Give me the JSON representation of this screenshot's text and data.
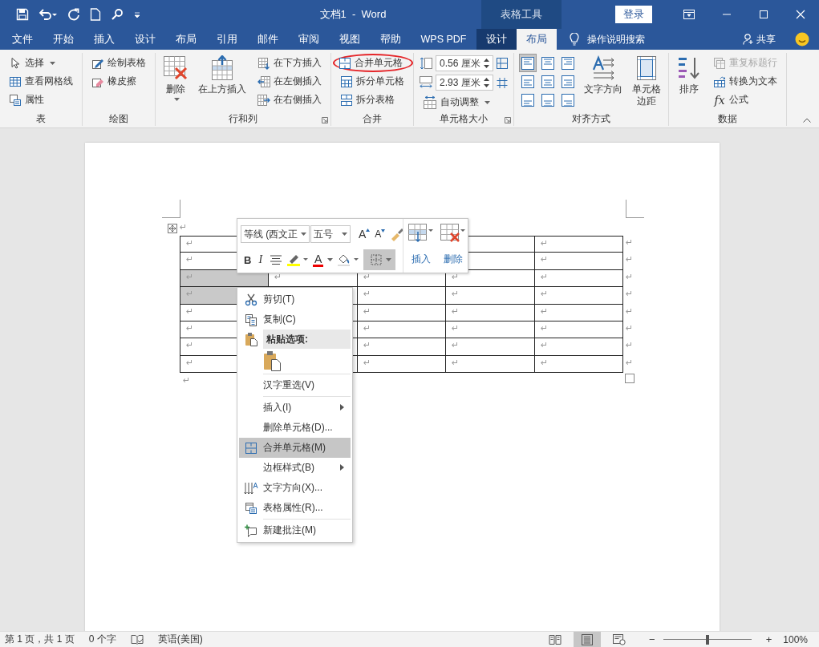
{
  "title_bar": {
    "title": "文档1  -  Word",
    "context_label": "表格工具",
    "sign_in": "登录"
  },
  "menu_tabs": [
    {
      "label": "文件",
      "selected": false,
      "contextual": false
    },
    {
      "label": "开始",
      "selected": false,
      "contextual": false
    },
    {
      "label": "插入",
      "selected": false,
      "contextual": false
    },
    {
      "label": "设计",
      "selected": false,
      "contextual": false
    },
    {
      "label": "布局",
      "selected": false,
      "contextual": false
    },
    {
      "label": "引用",
      "selected": false,
      "contextual": false
    },
    {
      "label": "邮件",
      "selected": false,
      "contextual": false
    },
    {
      "label": "审阅",
      "selected": false,
      "contextual": false
    },
    {
      "label": "视图",
      "selected": false,
      "contextual": false
    },
    {
      "label": "帮助",
      "selected": false,
      "contextual": false
    },
    {
      "label": "WPS PDF",
      "selected": false,
      "contextual": false
    },
    {
      "label": "设计",
      "selected": false,
      "contextual": true
    },
    {
      "label": "布局",
      "selected": true,
      "contextual": true
    }
  ],
  "tell_me": "操作说明搜索",
  "share": "共享",
  "ribbon": [
    {
      "label": "表",
      "launcher": false,
      "items": [
        {
          "kind": "stack",
          "buttons": [
            {
              "label": "选择",
              "dropdown": true,
              "disabled": false,
              "circled": false
            },
            {
              "label": "查看网格线",
              "dropdown": false,
              "disabled": false,
              "circled": false
            },
            {
              "label": "属性",
              "dropdown": false,
              "disabled": false,
              "circled": false
            }
          ]
        }
      ]
    },
    {
      "label": "绘图",
      "launcher": false,
      "items": [
        {
          "kind": "stack",
          "buttons": [
            {
              "label": "绘制表格",
              "dropdown": false,
              "disabled": false,
              "circled": false
            },
            {
              "label": "橡皮擦",
              "dropdown": false,
              "disabled": false,
              "circled": false
            }
          ]
        }
      ]
    },
    {
      "label": "行和列",
      "launcher": true,
      "items": [
        {
          "kind": "large",
          "lines": [
            "删除"
          ],
          "dropdown": true
        },
        {
          "kind": "large",
          "lines": [
            "在上方插入"
          ],
          "dropdown": false
        },
        {
          "kind": "stack",
          "buttons": [
            {
              "label": "在下方插入",
              "dropdown": false,
              "disabled": false,
              "circled": false
            },
            {
              "label": "在左侧插入",
              "dropdown": false,
              "disabled": false,
              "circled": false
            },
            {
              "label": "在右侧插入",
              "dropdown": false,
              "disabled": false,
              "circled": false
            }
          ]
        }
      ]
    },
    {
      "label": "合并",
      "launcher": false,
      "items": [
        {
          "kind": "stack",
          "buttons": [
            {
              "label": "合并单元格",
              "dropdown": false,
              "disabled": false,
              "circled": true
            },
            {
              "label": "拆分单元格",
              "dropdown": false,
              "disabled": false,
              "circled": false
            },
            {
              "label": "拆分表格",
              "dropdown": false,
              "disabled": false,
              "circled": false
            }
          ]
        }
      ]
    },
    {
      "label": "单元格大小",
      "launcher": true,
      "items": [
        {
          "kind": "fields",
          "fields": [
            {
              "value": "0.56 厘米"
            },
            {
              "value": "2.93 厘米"
            }
          ],
          "buttons": [
            {
              "label": "自动调整",
              "dropdown": true,
              "disabled": false,
              "circled": false
            }
          ]
        }
      ]
    },
    {
      "label": "对齐方式",
      "launcher": false,
      "items": [
        {
          "kind": "align-grid",
          "cells": [
            {
              "selected": true
            },
            {
              "selected": false
            },
            {
              "selected": false
            },
            {
              "selected": false
            },
            {
              "selected": false
            },
            {
              "selected": false
            },
            {
              "selected": false
            },
            {
              "selected": false
            },
            {
              "selected": false
            }
          ]
        },
        {
          "kind": "large",
          "lines": [
            "文字方向"
          ],
          "dropdown": false
        },
        {
          "kind": "large",
          "lines": [
            "单元格",
            "边距"
          ],
          "dropdown": false
        }
      ]
    },
    {
      "label": "数据",
      "launcher": false,
      "items": [
        {
          "kind": "large",
          "lines": [
            "排序"
          ],
          "dropdown": false
        },
        {
          "kind": "stack",
          "buttons": [
            {
              "label": "重复标题行",
              "dropdown": false,
              "disabled": true,
              "circled": false
            },
            {
              "label": "转换为文本",
              "dropdown": false,
              "disabled": false,
              "circled": false
            },
            {
              "label": "公式",
              "dropdown": false,
              "disabled": false,
              "circled": false,
              "glyph": "fx"
            }
          ]
        }
      ]
    }
  ],
  "document": {
    "anchor_mark": "↵",
    "after_mark": "↵",
    "table": {
      "rows": [
        {
          "end_mark": "↵",
          "cells": [
            {
              "mark": "↵",
              "selected": false
            },
            {},
            {},
            {
              "selected": false
            },
            {
              "mark": "↵",
              "selected": false
            }
          ]
        },
        {
          "end_mark": "↵",
          "cells": [
            {
              "mark": "↵",
              "selected": false
            },
            {},
            {},
            {
              "selected": false
            },
            {
              "mark": "↵",
              "selected": false
            }
          ]
        },
        {
          "end_mark": "↵",
          "cells": [
            {
              "mark": "↵",
              "selected": true
            },
            {
              "mark": "↵",
              "selected": false
            },
            {
              "mark": "↵",
              "selected": false
            },
            {
              "mark": "↵",
              "selected": false
            },
            {
              "mark": "↵",
              "selected": false
            }
          ]
        },
        {
          "end_mark": "↵",
          "cells": [
            {
              "mark": "↵",
              "selected": true
            },
            {
              "selected": false
            },
            {
              "mark": "↵",
              "selected": false
            },
            {
              "mark": "↵",
              "selected": false
            },
            {
              "mark": "↵",
              "selected": false
            }
          ]
        },
        {
          "end_mark": "↵",
          "cells": [
            {
              "mark": "↵",
              "selected": false
            },
            {
              "selected": false
            },
            {
              "mark": "↵",
              "selected": false
            },
            {
              "mark": "↵",
              "selected": false
            },
            {
              "mark": "↵",
              "selected": false
            }
          ]
        },
        {
          "end_mark": "↵",
          "cells": [
            {
              "mark": "↵",
              "selected": false
            },
            {
              "selected": false
            },
            {
              "mark": "↵",
              "selected": false
            },
            {
              "mark": "↵",
              "selected": false
            },
            {
              "mark": "↵",
              "selected": false
            }
          ]
        },
        {
          "end_mark": "↵",
          "cells": [
            {
              "mark": "↵",
              "selected": false
            },
            {
              "selected": false
            },
            {
              "mark": "↵",
              "selected": false
            },
            {
              "mark": "↵",
              "selected": false
            },
            {
              "mark": "↵",
              "selected": false
            }
          ]
        },
        {
          "end_mark": "↵",
          "cells": [
            {
              "mark": "↵",
              "selected": false
            },
            {
              "selected": false
            },
            {
              "mark": "↵",
              "selected": false
            },
            {
              "mark": "↵",
              "selected": false
            },
            {
              "mark": "↵",
              "selected": false
            }
          ]
        }
      ]
    }
  },
  "mini_toolbar": {
    "font": "等线 (西文正",
    "size": "五号",
    "grow": "A",
    "shrink": "A",
    "bold": "B",
    "italic": "I",
    "font_color": "A",
    "insert": "插入",
    "delete": "删除"
  },
  "context_menu": [
    {
      "kind": "command",
      "label": "剪切(T)",
      "submenu": false,
      "highlighted": false
    },
    {
      "kind": "command",
      "label": "复制(C)",
      "submenu": false,
      "highlighted": false
    },
    {
      "kind": "header",
      "label": "粘贴选项:"
    },
    {
      "kind": "paste-option"
    },
    {
      "kind": "separator"
    },
    {
      "kind": "command",
      "label": "汉字重选(V)",
      "submenu": false,
      "highlighted": false
    },
    {
      "kind": "separator"
    },
    {
      "kind": "command",
      "label": "插入(I)",
      "submenu": true,
      "highlighted": false
    },
    {
      "kind": "command",
      "label": "删除单元格(D)...",
      "submenu": false,
      "highlighted": false
    },
    {
      "kind": "command",
      "label": "合并单元格(M)",
      "submenu": false,
      "highlighted": true
    },
    {
      "kind": "command",
      "label": "边框样式(B)",
      "submenu": true,
      "highlighted": false
    },
    {
      "kind": "command",
      "label": "文字方向(X)...",
      "submenu": false,
      "highlighted": false
    },
    {
      "kind": "command",
      "label": "表格属性(R)...",
      "submenu": false,
      "highlighted": false
    },
    {
      "kind": "separator"
    },
    {
      "kind": "command",
      "label": "新建批注(M)",
      "submenu": false,
      "highlighted": false
    }
  ],
  "status_bar": {
    "page": "第 1 页，共 1 页",
    "words": "0 个字",
    "language": "英语(美国)",
    "views": [
      {
        "selected": false
      },
      {
        "selected": true
      },
      {
        "selected": false
      }
    ],
    "zoom": {
      "minus": "−",
      "plus": "+",
      "level": 0.5,
      "percent": "100%"
    }
  }
}
